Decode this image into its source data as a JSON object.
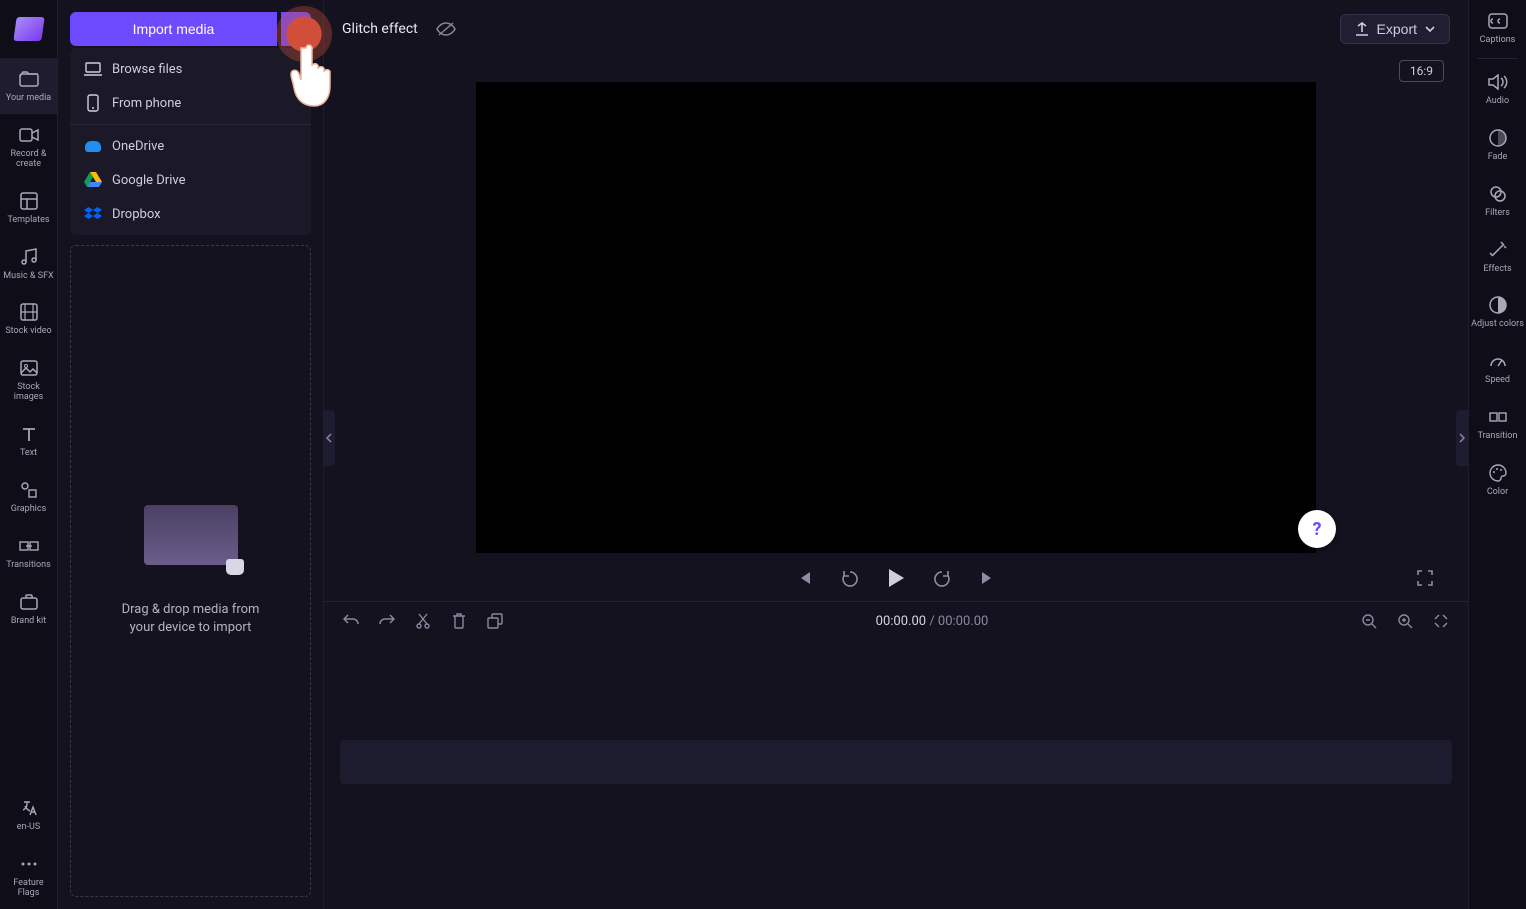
{
  "left_sidebar": {
    "items": [
      {
        "label": "Your media"
      },
      {
        "label": "Record & create"
      },
      {
        "label": "Templates"
      },
      {
        "label": "Music & SFX"
      },
      {
        "label": "Stock video"
      },
      {
        "label": "Stock images"
      },
      {
        "label": "Text"
      },
      {
        "label": "Graphics"
      },
      {
        "label": "Transitions"
      },
      {
        "label": "Brand kit"
      }
    ],
    "bottom": [
      {
        "label": "en-US"
      },
      {
        "label": "Feature Flags"
      }
    ]
  },
  "media_panel": {
    "import_label": "Import media",
    "dropdown": {
      "browse": "Browse files",
      "phone": "From phone",
      "onedrive": "OneDrive",
      "gdrive": "Google Drive",
      "dropbox": "Dropbox"
    },
    "dropzone_text": "Drag & drop media from your device to import"
  },
  "top_bar": {
    "project_name": "Glitch effect",
    "export_label": "Export"
  },
  "preview": {
    "aspect": "16:9"
  },
  "timeline": {
    "current_time": "00:00.00",
    "total_time": "00:00.00"
  },
  "right_sidebar": {
    "items": [
      {
        "label": "Captions"
      },
      {
        "label": "Audio"
      },
      {
        "label": "Fade"
      },
      {
        "label": "Filters"
      },
      {
        "label": "Effects"
      },
      {
        "label": "Adjust colors"
      },
      {
        "label": "Speed"
      },
      {
        "label": "Transition"
      },
      {
        "label": "Color"
      }
    ]
  },
  "help": "?"
}
